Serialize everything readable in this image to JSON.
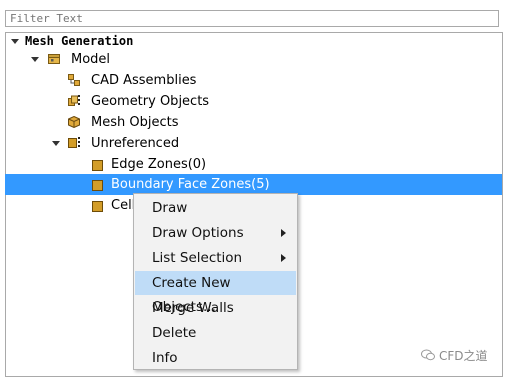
{
  "filter": {
    "placeholder": "Filter Text"
  },
  "tree": {
    "root": "Mesh Generation",
    "model": "Model",
    "items": [
      "CAD Assemblies",
      "Geometry Objects",
      "Mesh Objects"
    ],
    "unreferenced": "Unreferenced",
    "zones": [
      "Edge Zones(0)",
      "Boundary Face Zones(5)",
      "Cell"
    ]
  },
  "context_menu": {
    "items": [
      "Draw",
      "Draw Options",
      "List Selection",
      "Create New Objects...",
      "Merge Walls",
      "Delete",
      "Info"
    ]
  },
  "watermark": {
    "text": "CFD之道"
  },
  "colors": {
    "selection": "#3399ff",
    "menu_highlight": "#bfdcf7",
    "zone_icon": "#d39d28"
  }
}
